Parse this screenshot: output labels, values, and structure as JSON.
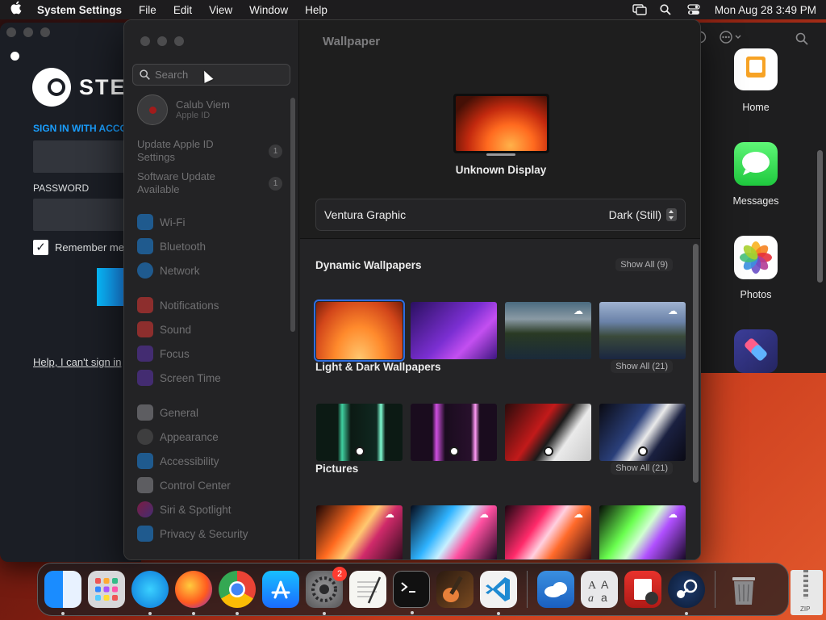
{
  "menubar": {
    "app_name": "System Settings",
    "menus": [
      "File",
      "Edit",
      "View",
      "Window",
      "Help"
    ],
    "clock": "Mon Aug 28  3:49 PM"
  },
  "steam": {
    "logo_text": "STEA",
    "signin_label": "SIGN IN WITH ACCO",
    "password_label": "PASSWORD",
    "remember_label": "Remember me",
    "help_link": "Help, I can't sign in"
  },
  "appwin": {
    "apps": [
      {
        "label": "Home"
      },
      {
        "label": "Messages"
      },
      {
        "label": "Photos"
      },
      {
        "label": ""
      }
    ]
  },
  "settings": {
    "search_placeholder": "Search",
    "profile": {
      "name": "Calub Viem",
      "sub": "Apple ID"
    },
    "notices": [
      {
        "label": "Update Apple ID Settings",
        "count": "1"
      },
      {
        "label": "Software Update Available",
        "count": "1"
      }
    ],
    "nav": [
      {
        "label": "Wi-Fi",
        "icon": "wifi-icon",
        "color": "#1e88e5"
      },
      {
        "label": "Bluetooth",
        "icon": "bluetooth-icon",
        "color": "#1e88e5"
      },
      {
        "label": "Network",
        "icon": "network-icon",
        "color": "#1e88e5"
      },
      {
        "label": "Notifications",
        "icon": "notifications-icon",
        "color": "#e53935"
      },
      {
        "label": "Sound",
        "icon": "sound-icon",
        "color": "#e53935"
      },
      {
        "label": "Focus",
        "icon": "focus-icon",
        "color": "#5e35b1"
      },
      {
        "label": "Screen Time",
        "icon": "screen-time-icon",
        "color": "#5e35b1"
      },
      {
        "label": "General",
        "icon": "general-icon",
        "color": "#8e8e93"
      },
      {
        "label": "Appearance",
        "icon": "appearance-icon",
        "color": "#333"
      },
      {
        "label": "Accessibility",
        "icon": "accessibility-icon",
        "color": "#1e88e5"
      },
      {
        "label": "Control Center",
        "icon": "control-center-icon",
        "color": "#8e8e93"
      },
      {
        "label": "Siri & Spotlight",
        "icon": "siri-icon",
        "color": "#c2185b"
      },
      {
        "label": "Privacy & Security",
        "icon": "privacy-icon",
        "color": "#1e88e5"
      }
    ],
    "content": {
      "title": "Wallpaper",
      "display_name": "Unknown Display",
      "wallpaper_name": "Ventura Graphic",
      "wallpaper_mode": "Dark (Still)",
      "sections": [
        {
          "title": "Dynamic Wallpapers",
          "show_all": "Show All (9)"
        },
        {
          "title": "Light & Dark Wallpapers",
          "show_all": "Show All (21)"
        },
        {
          "title": "Pictures",
          "show_all": "Show All (21)"
        }
      ]
    }
  },
  "dock": {
    "apps": [
      "Finder",
      "Launchpad",
      "Safari",
      "Firefox",
      "Chrome",
      "App Store",
      "System Settings",
      "TextEdit",
      "Terminal",
      "GarageBand",
      "VS Code",
      "Weather",
      "Font Book",
      "Photo Booth",
      "Steam",
      "Trash"
    ],
    "settings_badge": "2",
    "zip_label": "ZIP"
  }
}
